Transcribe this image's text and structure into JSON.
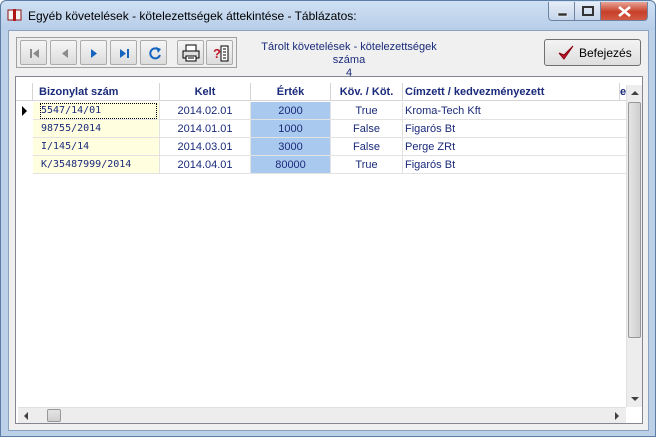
{
  "window": {
    "title": "Egyéb követelések - kötelezettségek áttekintése - Táblázatos:"
  },
  "toolbar": {
    "nav_buttons": [
      "first-record-icon",
      "prev-record-icon",
      "next-record-icon",
      "last-record-icon",
      "refresh-icon"
    ],
    "print_icon": "printer-icon",
    "help_icon": "help-icon",
    "stored_label": "Tárolt követelések - kötelezettségek száma",
    "stored_count": "4",
    "finish_label": "Befejezés"
  },
  "grid": {
    "headers": {
      "doc": "Bizonylat szám",
      "kelt": "Kelt",
      "ert": "Érték",
      "kov": "Köv. / Köt.",
      "cim": "Címzett / kedvezményezett",
      "extra": "e"
    },
    "rows": [
      {
        "doc": "5547/14/01",
        "kelt": "2014.02.01",
        "ert": "2000",
        "kov": "True",
        "cim": "Kroma-Tech Kft"
      },
      {
        "doc": "98755/2014",
        "kelt": "2014.01.01",
        "ert": "1000",
        "kov": "False",
        "cim": "Figarós Bt"
      },
      {
        "doc": "I/145/14",
        "kelt": "2014.03.01",
        "ert": "3000",
        "kov": "False",
        "cim": "Perge ZRt"
      },
      {
        "doc": "K/35487999/2014",
        "kelt": "2014.04.01",
        "ert": "80000",
        "kov": "True",
        "cim": "Figarós Bt"
      }
    ]
  },
  "colors": {
    "accent_text": "#1a2a7a",
    "value_column": "#aac9ee",
    "doc_column": "#ffffe0",
    "check_mark": "#c0182c"
  }
}
